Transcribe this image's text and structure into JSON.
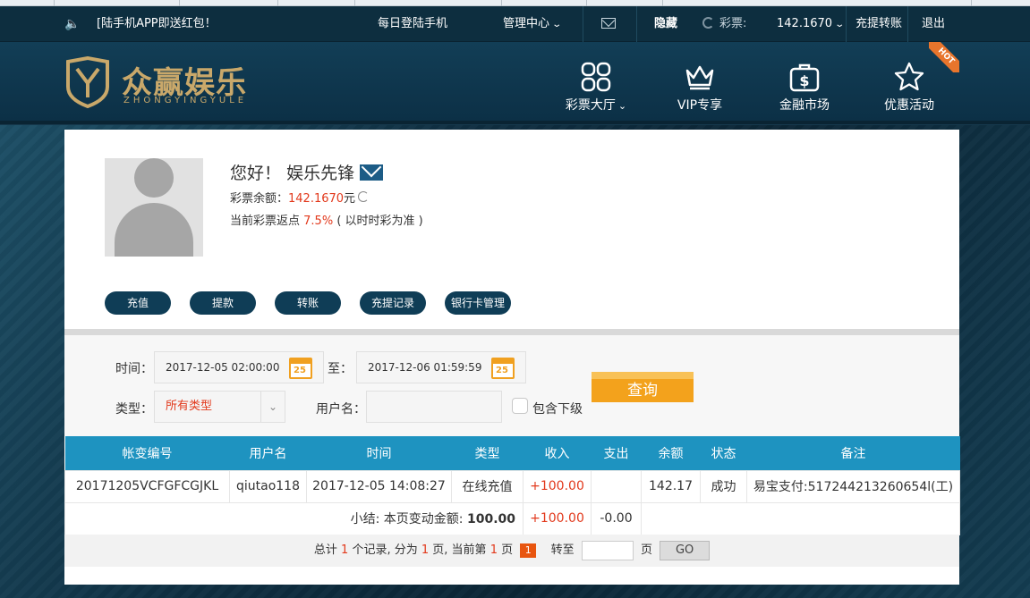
{
  "topbar": {
    "notice": "[陆手机APP即送红包！",
    "login_mobile": "每日登陆手机",
    "admin_center": "管理中心",
    "hide": "隐藏",
    "lottery_label": "彩票:",
    "lottery_balance": "142.1670",
    "deposit_transfer": "充提转账",
    "logout": "退出"
  },
  "logo": {
    "name": "众赢娱乐",
    "pinyin": "ZHONGYINGYULE",
    "accent": "#c9a86a"
  },
  "nav": [
    {
      "label": "彩票大厅",
      "icon": "grid-icon"
    },
    {
      "label": "VIP专享",
      "icon": "crown-icon"
    },
    {
      "label": "金融市场",
      "icon": "dollar-bag-icon"
    },
    {
      "label": "优惠活动",
      "icon": "star-icon"
    }
  ],
  "hot_badge": "HOT",
  "profile": {
    "greeting": "您好！",
    "username": "娱乐先锋",
    "balance_label": "彩票余额：",
    "balance": "142.1670",
    "balance_unit": "元",
    "rebate_label": "当前彩票返点",
    "rebate": "7.5%",
    "rebate_note": "( 以时时彩为准 )"
  },
  "actions": [
    "充值",
    "提款",
    "转账",
    "充提记录",
    "银行卡管理"
  ],
  "filter": {
    "time_label": "时间：",
    "start_time": "2017-12-05 02:00:00",
    "to_label": "至：",
    "end_time": "2017-12-06 01:59:59",
    "calendar_day": "25",
    "type_label": "类型：",
    "type_value": "所有类型",
    "username_label": "用户名：",
    "username_value": "",
    "include_sub_label": "包含下级",
    "query_button": "查询"
  },
  "table": {
    "headers": [
      "帐变编号",
      "用户名",
      "时间",
      "类型",
      "收入",
      "支出",
      "余额",
      "状态",
      "备注"
    ],
    "rows": [
      [
        "20171205VCFGFCGJKL",
        "qiutao118",
        "2017-12-05 14:08:27",
        "在线充值",
        "+100.00",
        "",
        "142.17",
        "成功",
        "易宝支付:517244213260654l(工)"
      ]
    ],
    "summary": {
      "label": "小结: 本页变动金额:",
      "amount": "100.00",
      "income": "+100.00",
      "expense": "-0.00"
    }
  },
  "pager": {
    "prefix": "总计",
    "total": "1",
    "records_text": "个记录, 分为",
    "pages": "1",
    "pages_text": "页, 当前第",
    "current": "1",
    "current_suffix": "页",
    "current_badge": "1",
    "goto_label": "转至",
    "page_unit": "页",
    "go_button": "GO"
  },
  "colors": {
    "income_red": "#e2391c",
    "table_header": "#1e93c0",
    "query_orange": "#f3a21c",
    "pill_navy": "#0f3d56"
  }
}
